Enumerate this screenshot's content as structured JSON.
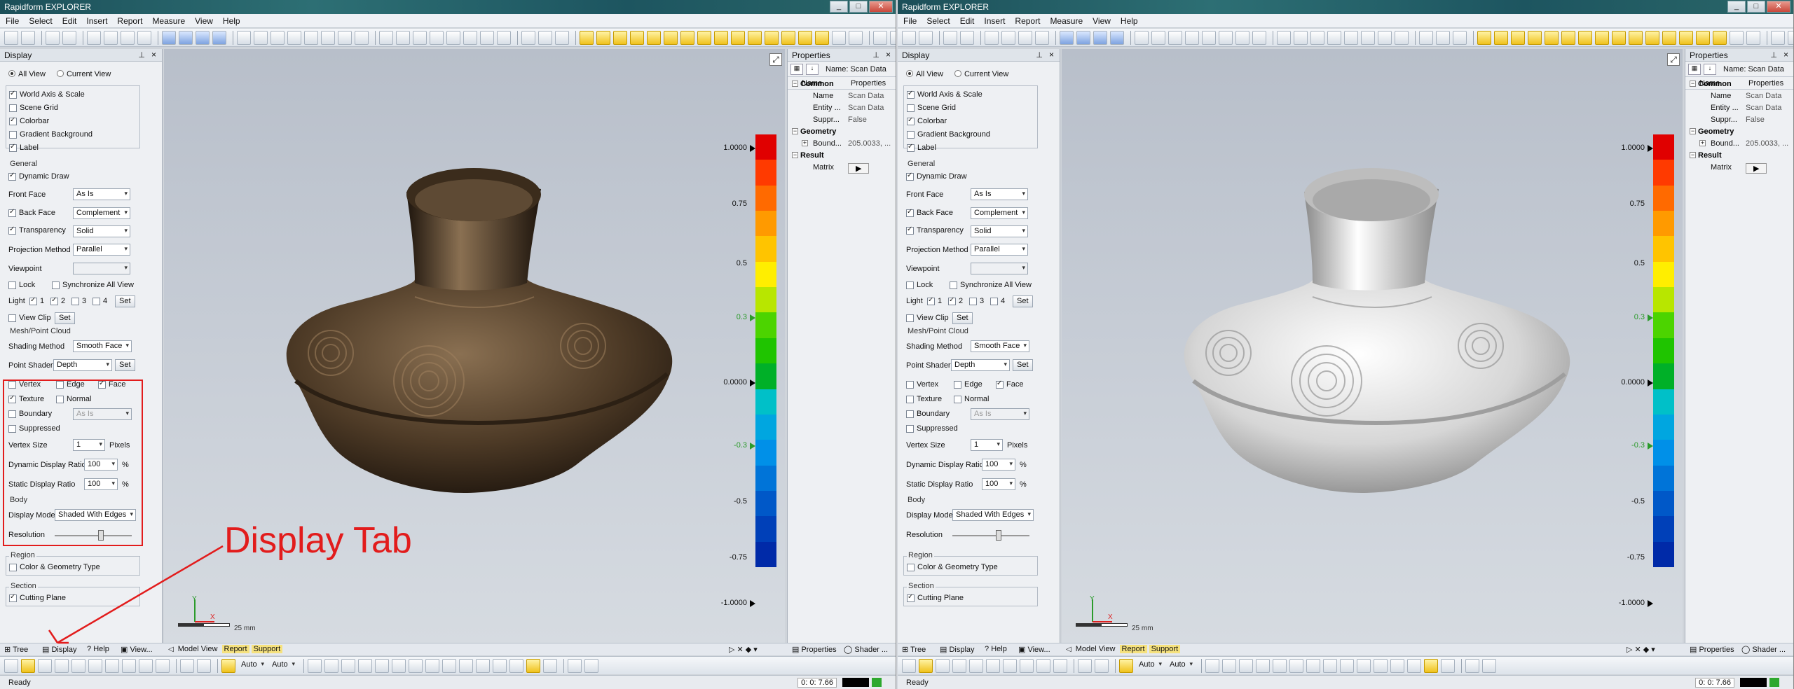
{
  "app": {
    "title": "Rapidform EXPLORER",
    "window_buttons": [
      "_",
      "□",
      "✕"
    ]
  },
  "menu": [
    "File",
    "Select",
    "Edit",
    "Insert",
    "Report",
    "Measure",
    "View",
    "Help"
  ],
  "display_panel": {
    "title": "Display",
    "view_scope": {
      "all": "All View",
      "current": "Current View",
      "selected": "all"
    },
    "top_checks": [
      {
        "label": "World Axis & Scale",
        "checked": true
      },
      {
        "label": "Scene Grid",
        "checked": false
      },
      {
        "label": "Colorbar",
        "checked": true
      },
      {
        "label": "Gradient Background",
        "checked": false
      },
      {
        "label": "Label",
        "checked": true
      }
    ],
    "general": {
      "title": "General",
      "dynamic_draw": {
        "label": "Dynamic Draw",
        "checked": true
      },
      "front_face": {
        "label": "Front Face",
        "value": "As Is"
      },
      "back_face": {
        "label": "Back Face",
        "value": "Complement",
        "checked": true
      },
      "transparency": {
        "label": "Transparency",
        "value": "Solid",
        "checked": true
      },
      "projection": {
        "label": "Projection Method",
        "value": "Parallel"
      },
      "viewpoint": {
        "label": "Viewpoint",
        "value": ""
      },
      "lock": {
        "label": "Lock",
        "checked": false
      },
      "sync": {
        "label": "Synchronize All View",
        "checked": false
      },
      "light": {
        "label": "Light",
        "items": [
          {
            "label": "1",
            "checked": true
          },
          {
            "label": "2",
            "checked": true
          },
          {
            "label": "3",
            "checked": false
          },
          {
            "label": "4",
            "checked": false
          }
        ],
        "set": "Set"
      },
      "view_clip": {
        "label": "View Clip",
        "checked": false,
        "set": "Set"
      }
    },
    "mesh": {
      "title": "Mesh/Point Cloud",
      "shading": {
        "label": "Shading Method",
        "value": "Smooth Face"
      },
      "point_shader": {
        "label": "Point Shader",
        "value": "Depth",
        "set": "Set"
      },
      "vertex": {
        "label": "Vertex",
        "checked": false
      },
      "edge": {
        "label": "Edge",
        "checked": false
      },
      "face": {
        "label": "Face",
        "checked": true
      },
      "texture": {
        "label": "Texture",
        "checked_left": true,
        "checked_right": false
      },
      "normal": {
        "label": "Normal",
        "checked": false
      },
      "boundary": {
        "label": "Boundary",
        "value": "As Is",
        "checked": false
      },
      "suppressed": {
        "label": "Suppressed",
        "checked": false
      },
      "vertex_size": {
        "label": "Vertex Size",
        "value": "1",
        "unit": "Pixels"
      },
      "dynamic_ratio": {
        "label": "Dynamic Display Ratio",
        "value": "100",
        "unit": "%"
      },
      "static_ratio": {
        "label": "Static Display Ratio",
        "value": "100",
        "unit": "%"
      }
    },
    "body": {
      "title": "Body",
      "display_mode": {
        "label": "Display Mode",
        "value": "Shaded With Edges"
      },
      "resolution": {
        "label": "Resolution",
        "level": 0.6
      }
    },
    "region": {
      "title": "Region",
      "color_geo": {
        "label": "Color & Geometry Type",
        "checked": false
      }
    },
    "section": {
      "title": "Section",
      "cutting_plane": {
        "label": "Cutting Plane",
        "checked": true
      }
    }
  },
  "viewport": {
    "colorbar_ticks": [
      "1.0000",
      "0.75",
      "0.5",
      "0.3",
      "0.0000",
      "-0.3",
      "-0.5",
      "-0.75",
      "-1.0000"
    ],
    "axis_x": "X",
    "axis_y": "Y",
    "scale_label": "25 mm"
  },
  "properties_panel": {
    "title": "Properties",
    "name_field": "Name: Scan Data",
    "columns": [
      "Name",
      "Properties"
    ],
    "rows": [
      {
        "section": "Common"
      },
      {
        "key": "Name",
        "value": "Scan Data"
      },
      {
        "key": "Entity ...",
        "value": "Scan Data"
      },
      {
        "key": "Suppr...",
        "value": "False"
      },
      {
        "section": "Geometry"
      },
      {
        "key": "Bound...",
        "value": "205.0033, ..."
      },
      {
        "section": "Result"
      },
      {
        "key": "Matrix",
        "value": "▶"
      }
    ]
  },
  "bottom_tabs": {
    "left": [
      "Tree",
      "Display",
      "Help",
      "View..."
    ],
    "view": [
      "Model View",
      "Report",
      "Support"
    ],
    "right": [
      "Properties",
      "Shader ..."
    ]
  },
  "bottom_toolbar": {
    "auto1": "Auto",
    "auto2": "Auto"
  },
  "status": {
    "text": "Ready",
    "coord": "0: 0: 7.66"
  },
  "annotation": {
    "text": "Display Tab",
    "color": "#e21c1c"
  },
  "colors": {
    "accent_yellow": "#f6e27e",
    "annotation_red": "#e21c1c"
  }
}
